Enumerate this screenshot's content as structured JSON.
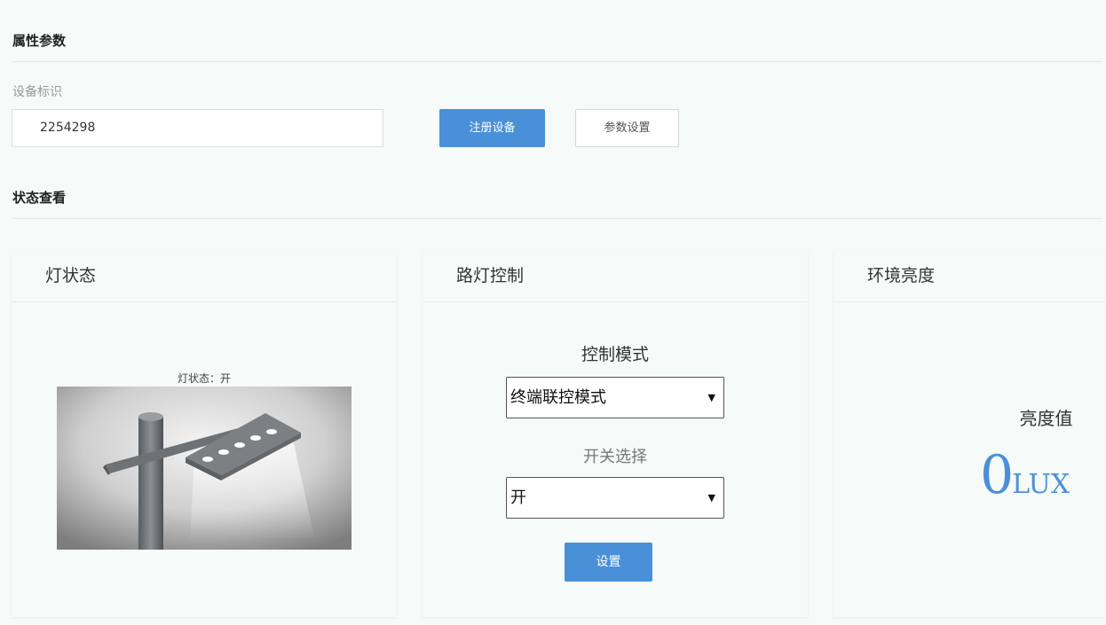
{
  "attributes": {
    "title": "属性参数",
    "device_label": "设备标识",
    "device_value": "2254298",
    "register_button": "注册设备",
    "settings_button": "参数设置"
  },
  "status": {
    "title": "状态查看"
  },
  "lamp_card": {
    "title": "灯状态",
    "caption": "灯状态：开"
  },
  "control_card": {
    "title": "路灯控制",
    "mode_label": "控制模式",
    "mode_value": "终端联控模式",
    "switch_label": "开关选择",
    "switch_value": "开",
    "set_button": "设置"
  },
  "brightness_card": {
    "title": "环境亮度",
    "label": "亮度值",
    "value": "0",
    "unit": "LUX"
  },
  "colors": {
    "accent": "#4a90d9",
    "background": "#f6faf8"
  }
}
